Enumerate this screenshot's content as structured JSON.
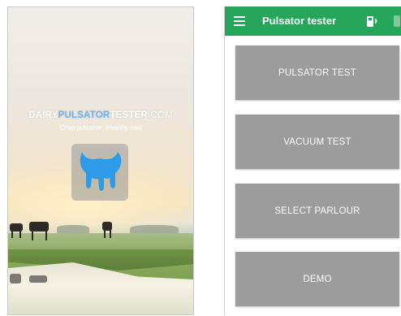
{
  "splash": {
    "brand_part1": "DAIRY",
    "brand_part2": "PULSATOR",
    "brand_part3": "TESTER",
    "brand_part4": ".COM",
    "tagline": "Crisp pulsation, Healthy cow",
    "logo_icon": "udder-icon",
    "colors": {
      "brand_accent": "#6fb6ee",
      "logo_blue": "#2e9be8"
    }
  },
  "app": {
    "appbar": {
      "title": "Pulsator tester",
      "menu_icon": "hamburger-menu-icon",
      "action_icon": "bluetooth-device-icon",
      "color": "#26a65b"
    },
    "buttons": [
      {
        "label": "PULSATOR TEST"
      },
      {
        "label": "VACUUM TEST"
      },
      {
        "label": "SELECT PARLOUR"
      },
      {
        "label": "DEMO"
      }
    ],
    "button_color": "#9c9c9c"
  }
}
